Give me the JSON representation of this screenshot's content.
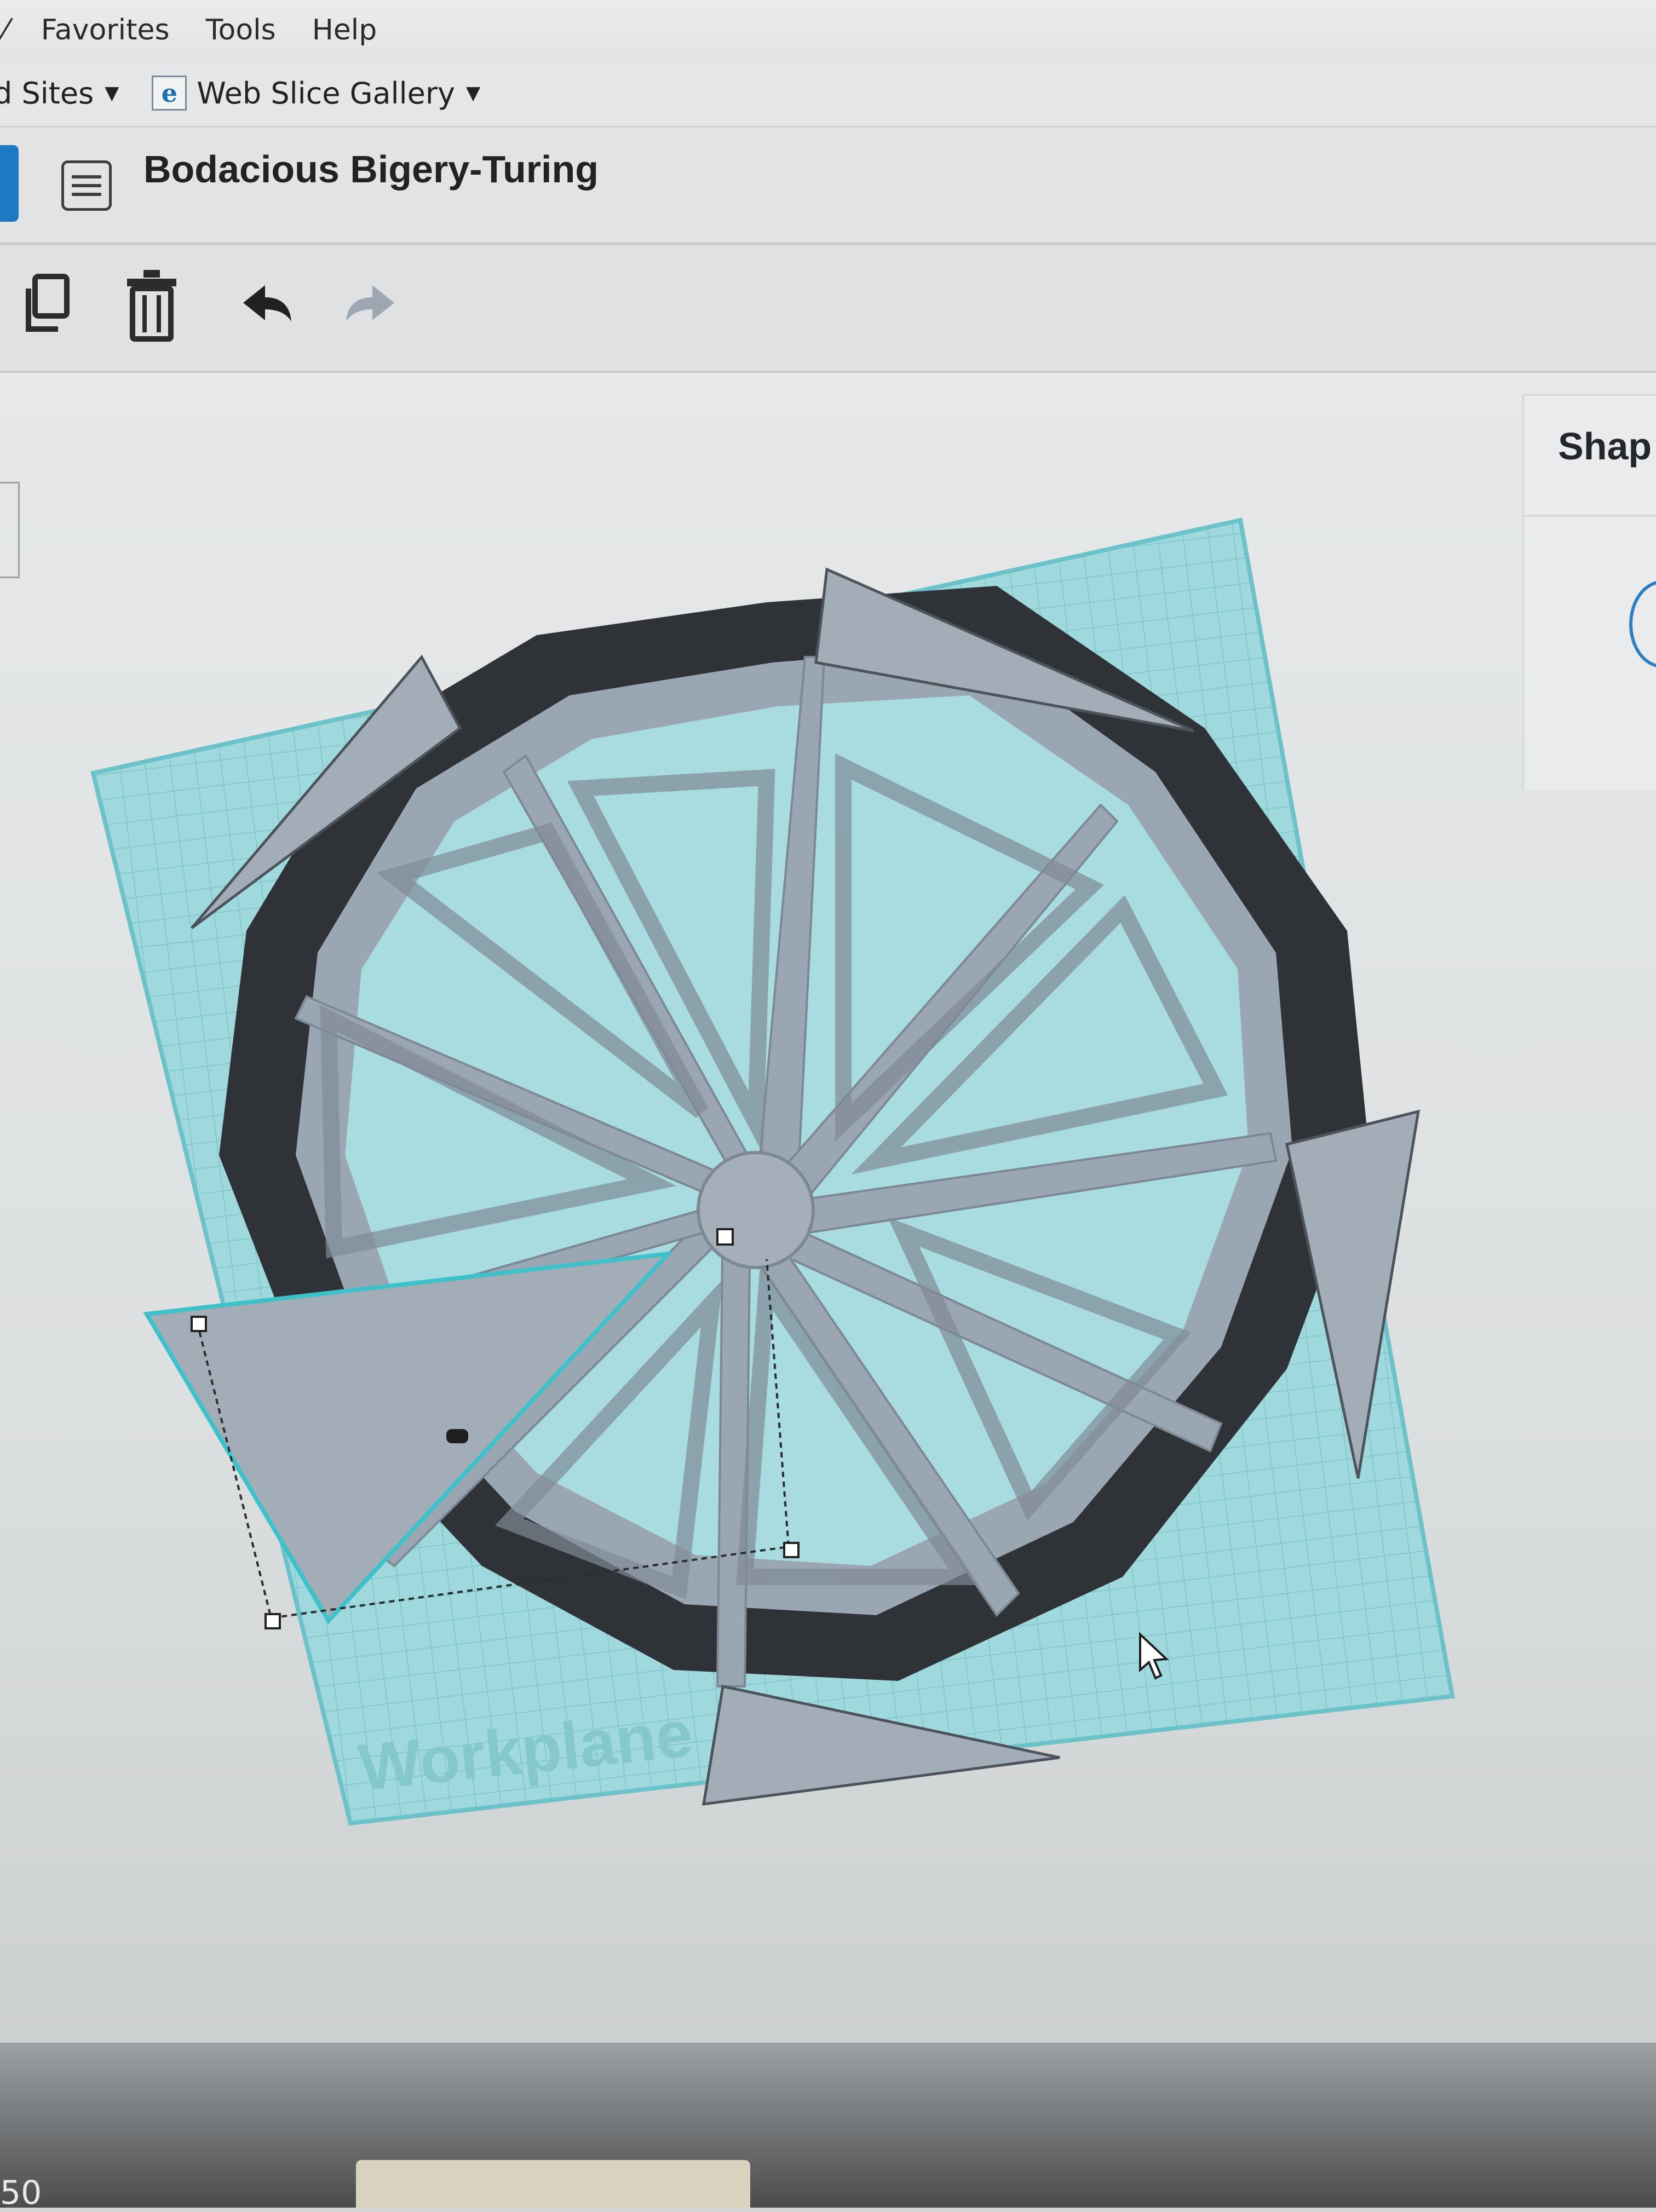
{
  "menubar": {
    "items": [
      {
        "label": "⁄"
      },
      {
        "label": "Favorites"
      },
      {
        "label": "Tools"
      },
      {
        "label": "Help"
      }
    ]
  },
  "favorites_bar": {
    "items": [
      {
        "label": "d Sites",
        "icon": "caret-down-icon"
      },
      {
        "label": "Web Slice Gallery",
        "icon": "ie-page-icon"
      }
    ]
  },
  "titlebar": {
    "design_title": "Bodacious Bigery-Turing",
    "icon": "design-list-icon"
  },
  "toolbar": {
    "tools": [
      "copy-icon",
      "trash-icon",
      "undo-icon",
      "redo-icon"
    ]
  },
  "workspace": {
    "workplane_label": "Workplane",
    "shapes_panel_title": "Shap",
    "colors": {
      "workplane": "#9ed9dd",
      "grid_line": "#7fc5cb",
      "shape_light": "#9fa9b4",
      "shape_dark": "#2d3035",
      "selection": "#3fc1c9"
    }
  },
  "bezel": {
    "label": "50"
  }
}
